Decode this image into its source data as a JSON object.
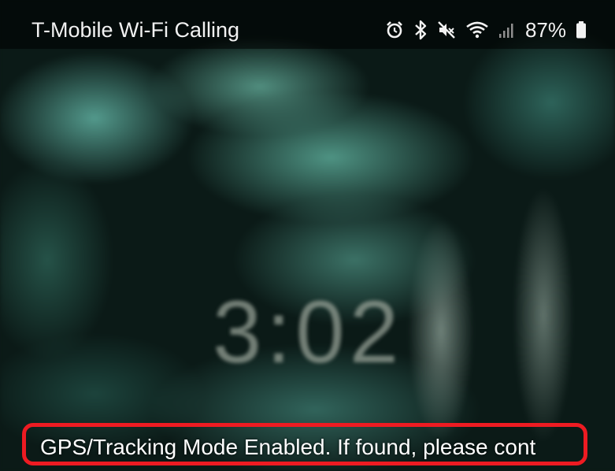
{
  "status_bar": {
    "carrier": "T-Mobile Wi-Fi Calling",
    "icons": [
      "alarm-icon",
      "bluetooth-icon",
      "mute-icon",
      "wifi-icon",
      "signal-icon",
      "battery-icon"
    ],
    "battery_percent": "87%"
  },
  "lockscreen": {
    "clock": "3:02"
  },
  "notice": {
    "text": "GPS/Tracking Mode Enabled. If found, please cont",
    "highlight_color": "#ee1b22"
  }
}
